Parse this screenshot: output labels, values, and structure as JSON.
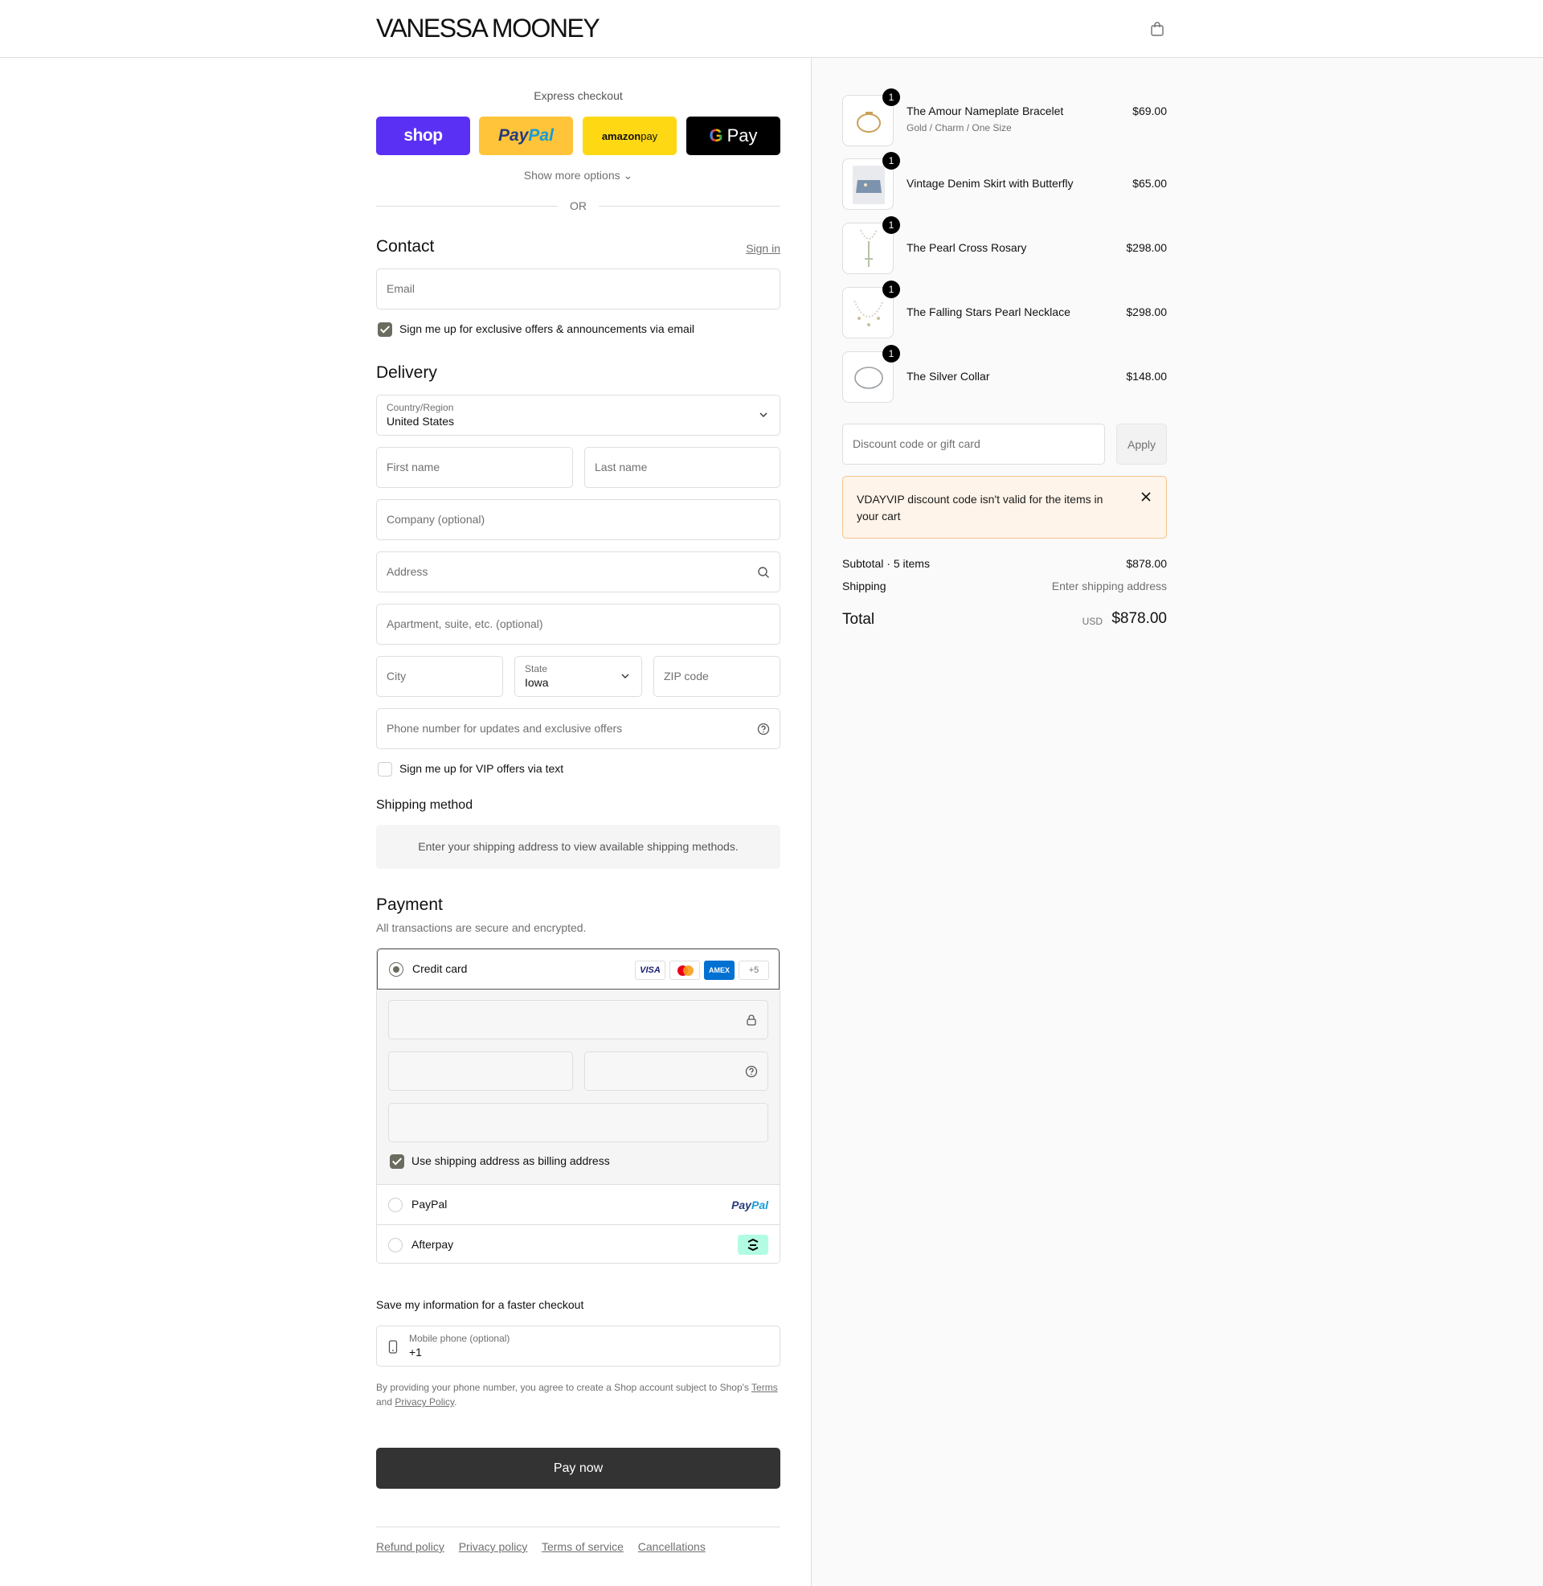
{
  "header": {
    "logo": "VANESSA MOONEY",
    "cart_icon": "shopping-bag-icon"
  },
  "express": {
    "title": "Express checkout",
    "shop_label": "shop",
    "paypal_label_1": "Pay",
    "paypal_label_2": "Pal",
    "amazon_label_1": "amazon",
    "amazon_label_2": " pay",
    "gpay_g": "G",
    "gpay_label": "Pay",
    "more_options": "Show more options ⌄",
    "or": "OR"
  },
  "contact": {
    "title": "Contact",
    "signin": "Sign in",
    "email_placeholder": "Email",
    "offers_checkbox_label": "Sign me up for exclusive offers & announcements via email",
    "offers_checked": true
  },
  "delivery": {
    "title": "Delivery",
    "country_label": "Country/Region",
    "country_value": "United States",
    "first_name_placeholder": "First name",
    "last_name_placeholder": "Last name",
    "company_placeholder": "Company (optional)",
    "address_placeholder": "Address",
    "apartment_placeholder": "Apartment, suite, etc. (optional)",
    "city_placeholder": "City",
    "state_label": "State",
    "state_value": "Iowa",
    "zip_placeholder": "ZIP code",
    "phone_placeholder": "Phone number for updates and exclusive offers",
    "vip_checkbox_label": "Sign me up for VIP offers via text",
    "vip_checked": false
  },
  "shipping_method": {
    "title": "Shipping method",
    "message": "Enter your shipping address to view available shipping methods."
  },
  "payment": {
    "title": "Payment",
    "subtitle": "All transactions are secure and encrypted.",
    "credit_card_label": "Credit card",
    "card_badges": {
      "visa": "VISA",
      "amex": "AMEX",
      "more": "+5"
    },
    "billing_checkbox_label": "Use shipping address as billing address",
    "billing_checked": true,
    "paypal_label": "PayPal",
    "paypal_logo_1": "Pay",
    "paypal_logo_2": "Pal",
    "afterpay_label": "Afterpay"
  },
  "save_info": {
    "title": "Save my information for a faster checkout",
    "phone_label": "Mobile phone (optional)",
    "phone_value": "+1",
    "terms_prefix": "By providing your phone number, you agree to create a Shop account subject to Shop's ",
    "terms_link": "Terms",
    "terms_and": " and ",
    "privacy_link": "Privacy Policy",
    "terms_suffix": "."
  },
  "pay_now": "Pay now",
  "footer": {
    "links": [
      "Refund policy",
      "Privacy policy",
      "Terms of service",
      "Cancellations"
    ]
  },
  "cart": {
    "items": [
      {
        "name": "The Amour Nameplate Bracelet",
        "variant": "Gold / Charm / One Size",
        "price": "$69.00",
        "qty": "1"
      },
      {
        "name": "Vintage Denim Skirt with Butterfly",
        "variant": "",
        "price": "$65.00",
        "qty": "1"
      },
      {
        "name": "The Pearl Cross Rosary",
        "variant": "",
        "price": "$298.00",
        "qty": "1"
      },
      {
        "name": "The Falling Stars Pearl Necklace",
        "variant": "",
        "price": "$298.00",
        "qty": "1"
      },
      {
        "name": "The Silver Collar",
        "variant": "",
        "price": "$148.00",
        "qty": "1"
      }
    ],
    "discount_placeholder": "Discount code or gift card",
    "apply_label": "Apply",
    "alert_text": "VDAYVIP discount code isn't valid for the items in your cart",
    "subtotal_label": "Subtotal · 5 items",
    "subtotal_value": "$878.00",
    "shipping_label": "Shipping",
    "shipping_value": "Enter shipping address",
    "total_label": "Total",
    "total_currency": "USD",
    "total_value": "$878.00"
  }
}
